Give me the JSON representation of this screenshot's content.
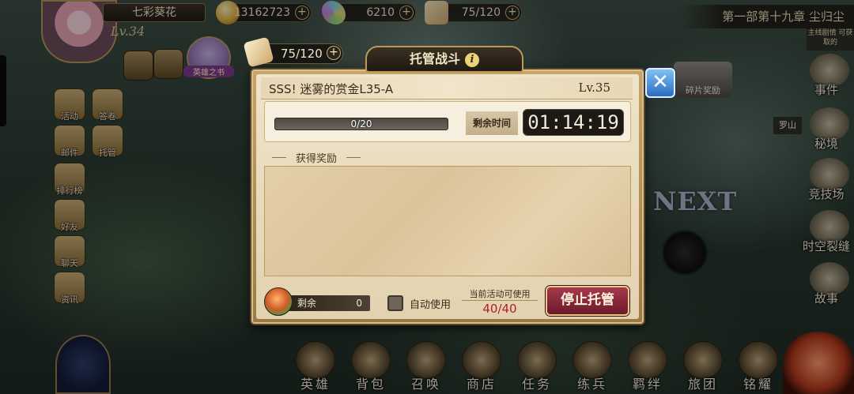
{
  "player": {
    "name": "七彩葵花",
    "level": "Lv.34"
  },
  "resources": {
    "gold": {
      "value": "13162723",
      "icon": "gold-coin-icon"
    },
    "crystal": {
      "value": "6210",
      "icon": "feather-crystal-icon"
    },
    "stamina": {
      "value": "75/120",
      "icon": "bread-icon"
    }
  },
  "chapter": {
    "title": "第一部第十九章 尘归尘",
    "tag": "主线剧情 可获取的"
  },
  "hero_book": {
    "label": "英雄之书"
  },
  "left_menu": [
    {
      "label": "活动"
    },
    {
      "label": "答卷"
    },
    {
      "label": "邮件"
    },
    {
      "label": "托管"
    },
    {
      "label": "排行榜"
    },
    {
      "label": "好友"
    },
    {
      "label": "聊天"
    },
    {
      "label": "资讯"
    }
  ],
  "right_menu": [
    {
      "label": "事件"
    },
    {
      "label": "秘境"
    },
    {
      "label": "竞技场"
    },
    {
      "label": "时空裂缝"
    },
    {
      "label": "故事"
    }
  ],
  "map": {
    "next_label": "NEXT",
    "reward_fragment_label": "碎片奖励",
    "mid_tag": "罗山"
  },
  "bottom_nav": [
    {
      "label": "英雄"
    },
    {
      "label": "背包"
    },
    {
      "label": "召唤"
    },
    {
      "label": "商店"
    },
    {
      "label": "任务"
    },
    {
      "label": "练兵"
    },
    {
      "label": "羁绊"
    },
    {
      "label": "旅团"
    },
    {
      "label": "铭耀"
    }
  ],
  "dialog": {
    "title": "托管战斗",
    "info_icon": "i",
    "close_icon": "✕",
    "stamina_value": "75/120",
    "stage_name": "SSS!  迷雾的赏金L35-A",
    "stage_level": "Lv.35",
    "progress_text": "0/20",
    "progress_fraction": 0,
    "remaining_time_label": "剩余时间",
    "remaining_time": "01:14:19",
    "rewards_title": "获得奖励",
    "remaining_label": "剩余",
    "remaining_count": "0",
    "auto_use_label": "自动使用",
    "auto_use_checked": false,
    "event_available_label": "当前活动可使用",
    "event_available_count": "40/40",
    "stop_button_label": "停止托管"
  }
}
